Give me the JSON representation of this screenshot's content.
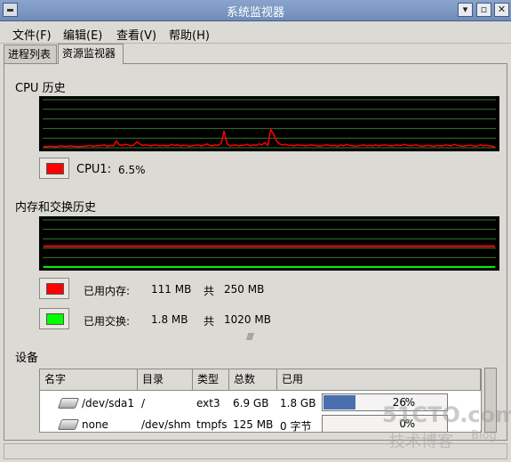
{
  "window": {
    "title": "系统监视器",
    "left_button": "",
    "buttons": [
      "▾",
      "▫",
      "✕"
    ]
  },
  "menubar": {
    "items": [
      "文件(F)",
      "编辑(E)",
      "查看(V)",
      "帮助(H)"
    ]
  },
  "tabs": [
    {
      "label": "进程列表",
      "active": false
    },
    {
      "label": "资源监视器",
      "active": true
    }
  ],
  "cpu": {
    "title": "CPU 历史",
    "legend_label": "CPU1:",
    "legend_value": "6.5%",
    "color": "#ff0000",
    "history": [
      3,
      2,
      3,
      3,
      2,
      3,
      4,
      3,
      3,
      4,
      3,
      3,
      2,
      3,
      3,
      4,
      5,
      3,
      4,
      4,
      5,
      6,
      3,
      5,
      4,
      14,
      6,
      5,
      7,
      6,
      4,
      6,
      12,
      8,
      5,
      6,
      5,
      4,
      6,
      5,
      4,
      5,
      4,
      4,
      7,
      5,
      6,
      4,
      5,
      5,
      3,
      4,
      5,
      6,
      4,
      5,
      8,
      5,
      4,
      6,
      5,
      9,
      35,
      8,
      4,
      5,
      6,
      4,
      5,
      5,
      7,
      4,
      6,
      5,
      8,
      6,
      11,
      5,
      38,
      28,
      14,
      8,
      6,
      7,
      5,
      5,
      4,
      6,
      5,
      5,
      4,
      5,
      6,
      5,
      4,
      3,
      5,
      6,
      5,
      4,
      5,
      3,
      6,
      4,
      7,
      5,
      4,
      3,
      4,
      5,
      6,
      4,
      5,
      4,
      6,
      4,
      5,
      6,
      5,
      4,
      4,
      6,
      5,
      5,
      7,
      5,
      4,
      5,
      6,
      4,
      3,
      4,
      5,
      4,
      3,
      5,
      4,
      4,
      6,
      5,
      4,
      7,
      5,
      4,
      3,
      4,
      5,
      5,
      3,
      4,
      6,
      4,
      5,
      4,
      3,
      2
    ]
  },
  "memory": {
    "title": "内存和交换历史",
    "mem_label": "已用内存:",
    "mem_used": "111 MB",
    "mem_sep": "共",
    "mem_total": "250 MB",
    "mem_color": "#ff0000",
    "mem_fraction": 0.444,
    "swap_label": "已用交换:",
    "swap_used": "1.8 MB",
    "swap_sep": "共",
    "swap_total": "1020 MB",
    "swap_color": "#00ff00",
    "swap_fraction": 0.002
  },
  "devices": {
    "title": "设备",
    "columns": [
      "名字",
      "目录",
      "类型",
      "总数",
      "已用"
    ],
    "rows": [
      {
        "name": "/dev/sda1",
        "dir": "/",
        "type": "ext3",
        "total": "6.9 GB",
        "used": "1.8 GB",
        "percent": "26",
        "percent_sign": "%",
        "fraction": 0.26
      },
      {
        "name": "none",
        "dir": "/dev/shm",
        "type": "tmpfs",
        "total": "125 MB",
        "used": "0 字节",
        "percent": "0",
        "percent_sign": "%",
        "fraction": 0
      }
    ]
  },
  "watermark": {
    "line1": "51CTO.com",
    "line2": "技术博客",
    "line3": "Blog"
  }
}
